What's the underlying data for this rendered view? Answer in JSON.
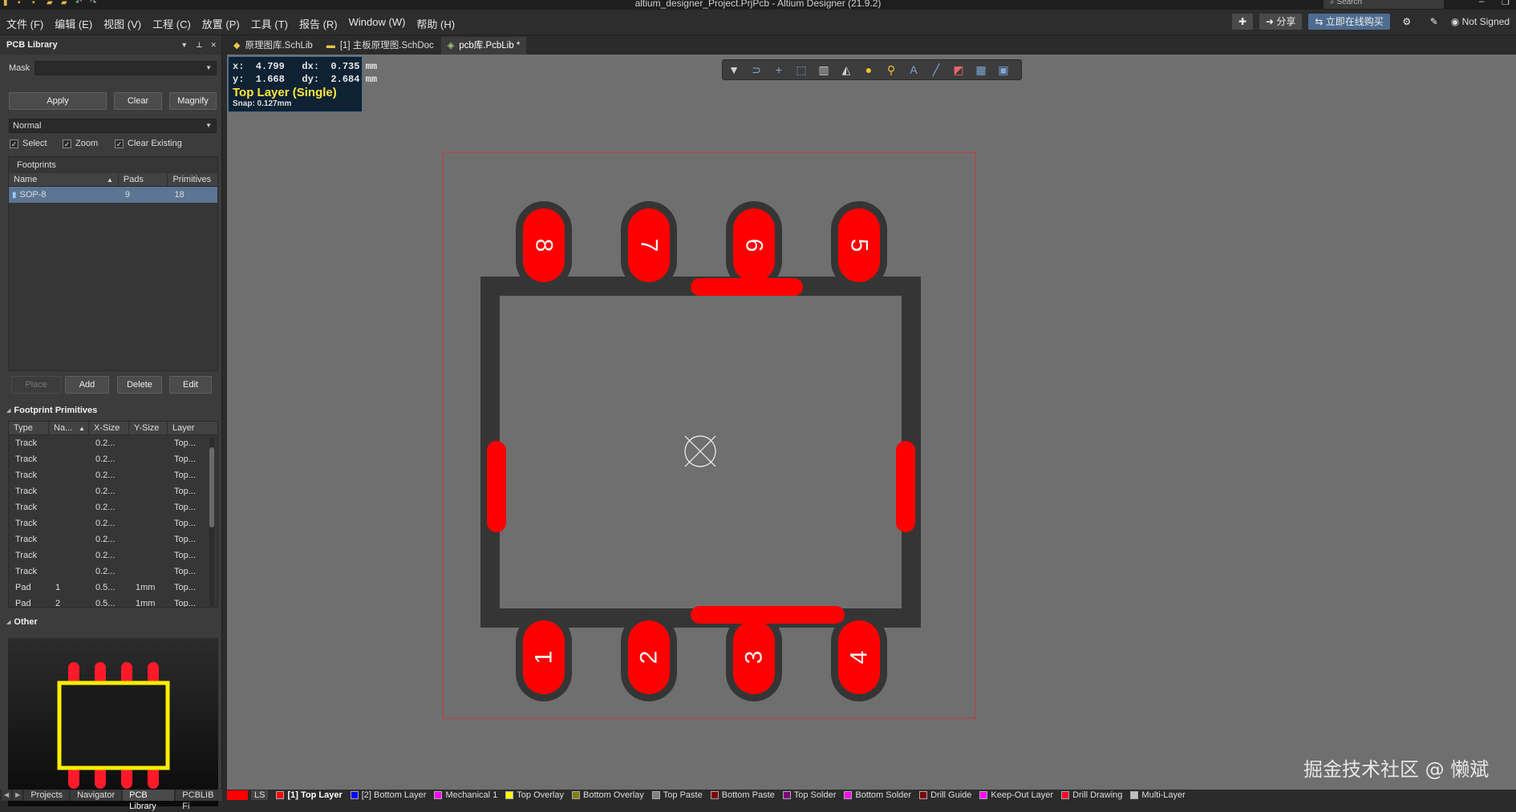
{
  "window": {
    "title": "altium_designer_Project.PrjPcb - Altium Designer (21.9.2)",
    "search_placeholder": "Search"
  },
  "menu": {
    "items": [
      "文件 (F)",
      "编辑 (E)",
      "视图 (V)",
      "工程 (C)",
      "放置 (P)",
      "工具 (T)",
      "报告 (R)",
      "Window (W)",
      "帮助 (H)"
    ],
    "share": "分享",
    "buy": "立即在线购买",
    "user": "Not Signed"
  },
  "panel": {
    "title": "PCB Library",
    "mask_label": "Mask",
    "mask_value": "",
    "apply": "Apply",
    "clear": "Clear",
    "magnify": "Magnify",
    "mode": "Normal",
    "checks": [
      {
        "label": "Select",
        "checked": true
      },
      {
        "label": "Zoom",
        "checked": true
      },
      {
        "label": "Clear Existing",
        "checked": true
      }
    ],
    "footprints": {
      "title": "Footprints",
      "columns": [
        "Name",
        "Pads",
        "Primitives"
      ],
      "rows": [
        {
          "name": "SOP-8",
          "pads": "9",
          "primitives": "18"
        }
      ]
    },
    "place": "Place",
    "add": "Add",
    "delete": "Delete",
    "edit": "Edit",
    "primitives": {
      "title": "Footprint Primitives",
      "columns": [
        "Type",
        "Na...",
        "X-Size",
        "Y-Size",
        "Layer"
      ],
      "rows": [
        [
          "Track",
          "",
          "0.2...",
          "",
          "Top..."
        ],
        [
          "Track",
          "",
          "0.2...",
          "",
          "Top..."
        ],
        [
          "Track",
          "",
          "0.2...",
          "",
          "Top..."
        ],
        [
          "Track",
          "",
          "0.2...",
          "",
          "Top..."
        ],
        [
          "Track",
          "",
          "0.2...",
          "",
          "Top..."
        ],
        [
          "Track",
          "",
          "0.2...",
          "",
          "Top..."
        ],
        [
          "Track",
          "",
          "0.2...",
          "",
          "Top..."
        ],
        [
          "Track",
          "",
          "0.2...",
          "",
          "Top..."
        ],
        [
          "Track",
          "",
          "0.2...",
          "",
          "Top..."
        ],
        [
          "Pad",
          "1",
          "0.5...",
          "1mm",
          "Top..."
        ],
        [
          "Pad",
          "2",
          "0.5...",
          "1mm",
          "Top..."
        ]
      ]
    },
    "other_title": "Other"
  },
  "bottom_tabs": [
    "Projects",
    "Navigator",
    "PCB Library",
    "PCBLIB Fi"
  ],
  "doc_tabs": [
    {
      "label": "原理图库.SchLib",
      "active": false
    },
    {
      "label": "[1] 主板原理图.SchDoc",
      "active": false
    },
    {
      "label": "pcb库.PcbLib *",
      "active": true
    }
  ],
  "coord": {
    "x_line": "x:  4.799   dx:  0.735 mm",
    "y_line": "y:  1.668   dy:  2.684 mm",
    "layer": "Top Layer (Single)",
    "snap": "Snap: 0.127mm"
  },
  "pads": {
    "top": [
      "8",
      "7",
      "6",
      "5"
    ],
    "bottom": [
      "1",
      "2",
      "3",
      "4"
    ]
  },
  "watermark": "掘金技术社区 @ 懒斌",
  "layers": [
    {
      "label": "[1] Top Layer",
      "color": "#ff0000",
      "active": true
    },
    {
      "label": "[2] Bottom Layer",
      "color": "#0000ff",
      "active": false
    },
    {
      "label": "Mechanical 1",
      "color": "#ff00ff",
      "active": false
    },
    {
      "label": "Top Overlay",
      "color": "#ffff00",
      "active": false
    },
    {
      "label": "Bottom Overlay",
      "color": "#808000",
      "active": false
    },
    {
      "label": "Top Paste",
      "color": "#808080",
      "active": false
    },
    {
      "label": "Bottom Paste",
      "color": "#800000",
      "active": false
    },
    {
      "label": "Top Solder",
      "color": "#800080",
      "active": false
    },
    {
      "label": "Bottom Solder",
      "color": "#ff00ff",
      "active": false
    },
    {
      "label": "Drill Guide",
      "color": "#800000",
      "active": false
    },
    {
      "label": "Keep-Out Layer",
      "color": "#ff00ff",
      "active": false
    },
    {
      "label": "Drill Drawing",
      "color": "#ff002a",
      "active": false
    },
    {
      "label": "Multi-Layer",
      "color": "#c0c0c0",
      "active": false
    }
  ],
  "ls_label": "LS"
}
